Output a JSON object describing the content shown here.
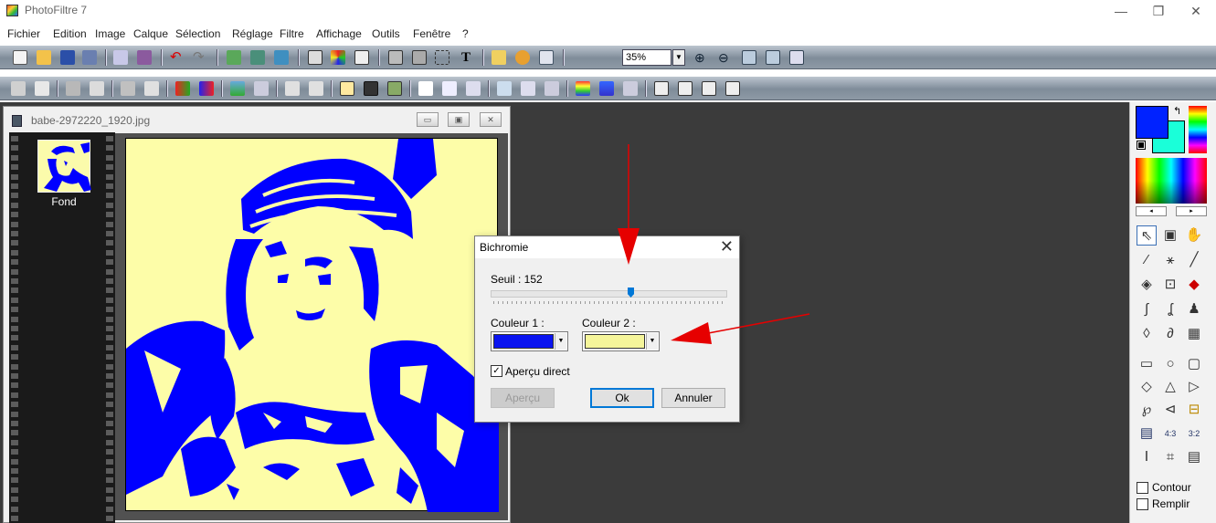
{
  "app": {
    "title": "PhotoFiltre 7",
    "window_controls": [
      "—",
      "❐",
      "✕"
    ]
  },
  "menu": [
    "Fichier",
    "Edition",
    "Image",
    "Calque",
    "Sélection",
    "Réglage",
    "Filtre",
    "Affichage",
    "Outils",
    "Fenêtre",
    "?"
  ],
  "toolbar": {
    "zoom_value": "35%"
  },
  "document": {
    "title": "babe-2972220_1920.jpg",
    "layer_name": "Fond"
  },
  "dialog": {
    "title": "Bichromie",
    "close_glyph": "✕",
    "threshold_label": "Seuil : 152",
    "threshold_value": 152,
    "threshold_max": 255,
    "color1_label": "Couleur 1 :",
    "color1": "#0a14f0",
    "color2_label": "Couleur 2 :",
    "color2": "#f5f59a",
    "preview_checkbox_label": "Aperçu direct",
    "preview_checked": true,
    "preview_button": "Aperçu",
    "ok_button": "Ok",
    "cancel_button": "Annuler"
  },
  "right_panel": {
    "foreground_color": "#0022ff",
    "background_color": "#1affd9",
    "contour_label": "Contour",
    "remplir_label": "Remplir"
  },
  "colors": {
    "annotation_arrow": "#e60000",
    "workspace": "#3b3b3b",
    "bichromie_blue": "#0000ff",
    "bichromie_yellow": "#fdfda8"
  }
}
